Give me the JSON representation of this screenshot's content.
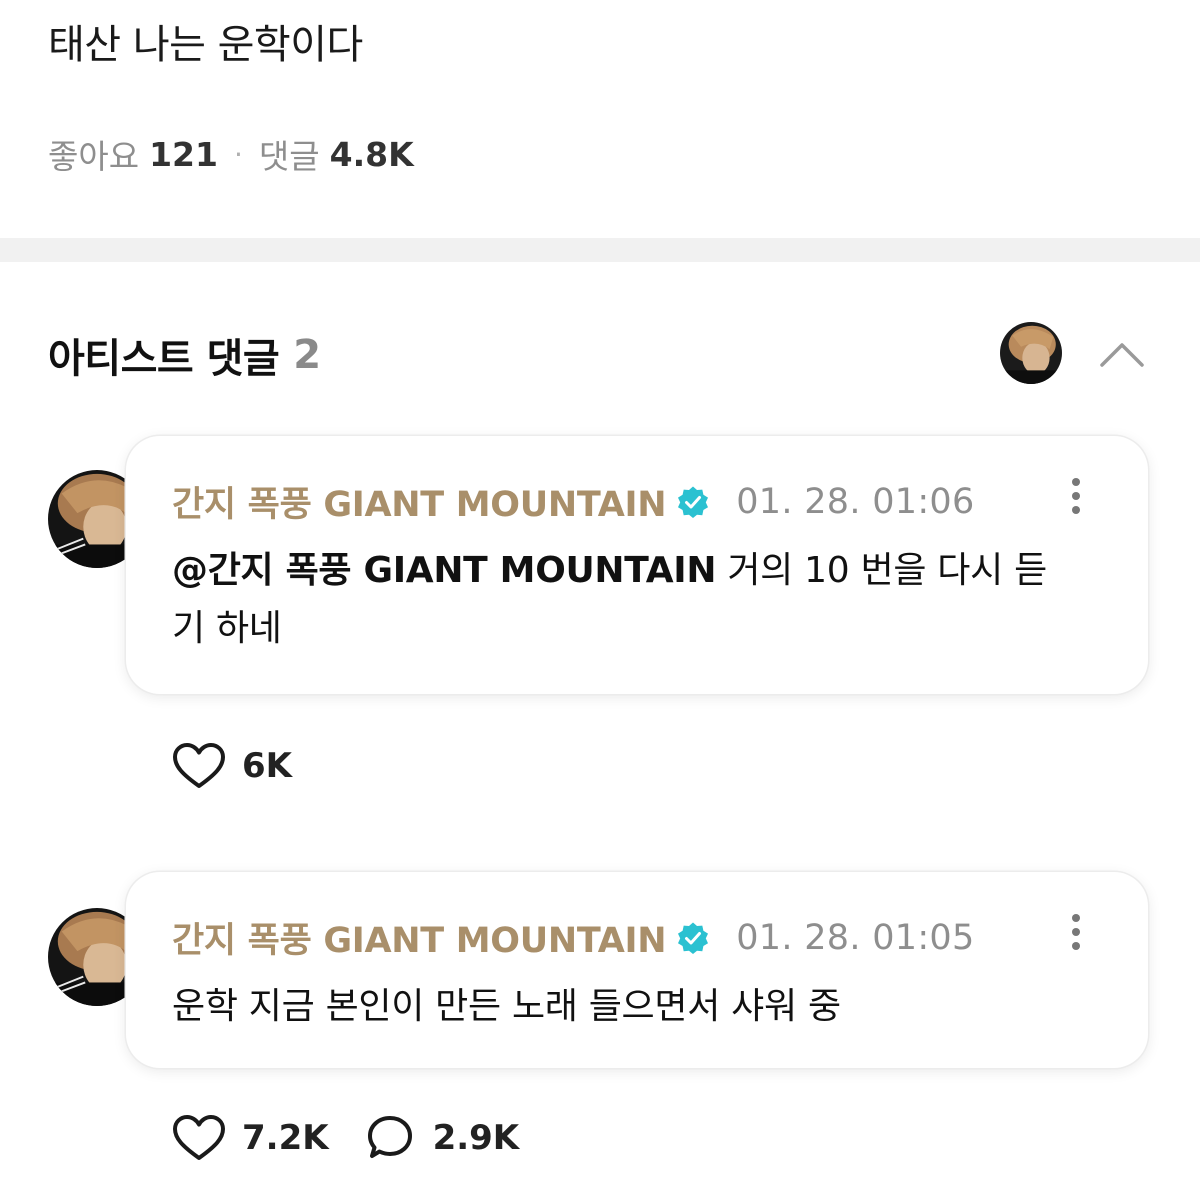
{
  "post": {
    "text": "태산 나는 운학이다",
    "likes_label": "좋아요",
    "likes_count": "121",
    "separator": "·",
    "comments_label": "댓글",
    "comments_count": "4.8K"
  },
  "artist_comments": {
    "title": "아티스트 댓글",
    "count": "2",
    "collapse_icon": "chevron-up-icon"
  },
  "comments": [
    {
      "author": "간지 폭풍 GIANT MOUNTAIN",
      "verified": true,
      "timestamp": "01. 28. 01:06",
      "mention": "@간지 폭풍 GIANT MOUNTAIN",
      "text": " 거의 10 번을 다시 듣기 하네",
      "likes": "6K"
    },
    {
      "author": "간지 폭풍 GIANT MOUNTAIN",
      "verified": true,
      "timestamp": "01. 28. 01:05",
      "text": "운학 지금 본인이 만든 노래 들으면서 샤워 중",
      "likes": "7.2K",
      "replies": "2.9K"
    }
  ],
  "colors": {
    "author": "#a98f6a",
    "verified": "#2bc1d1",
    "muted": "#8e8e8e",
    "divider": "#f1f1f1"
  }
}
